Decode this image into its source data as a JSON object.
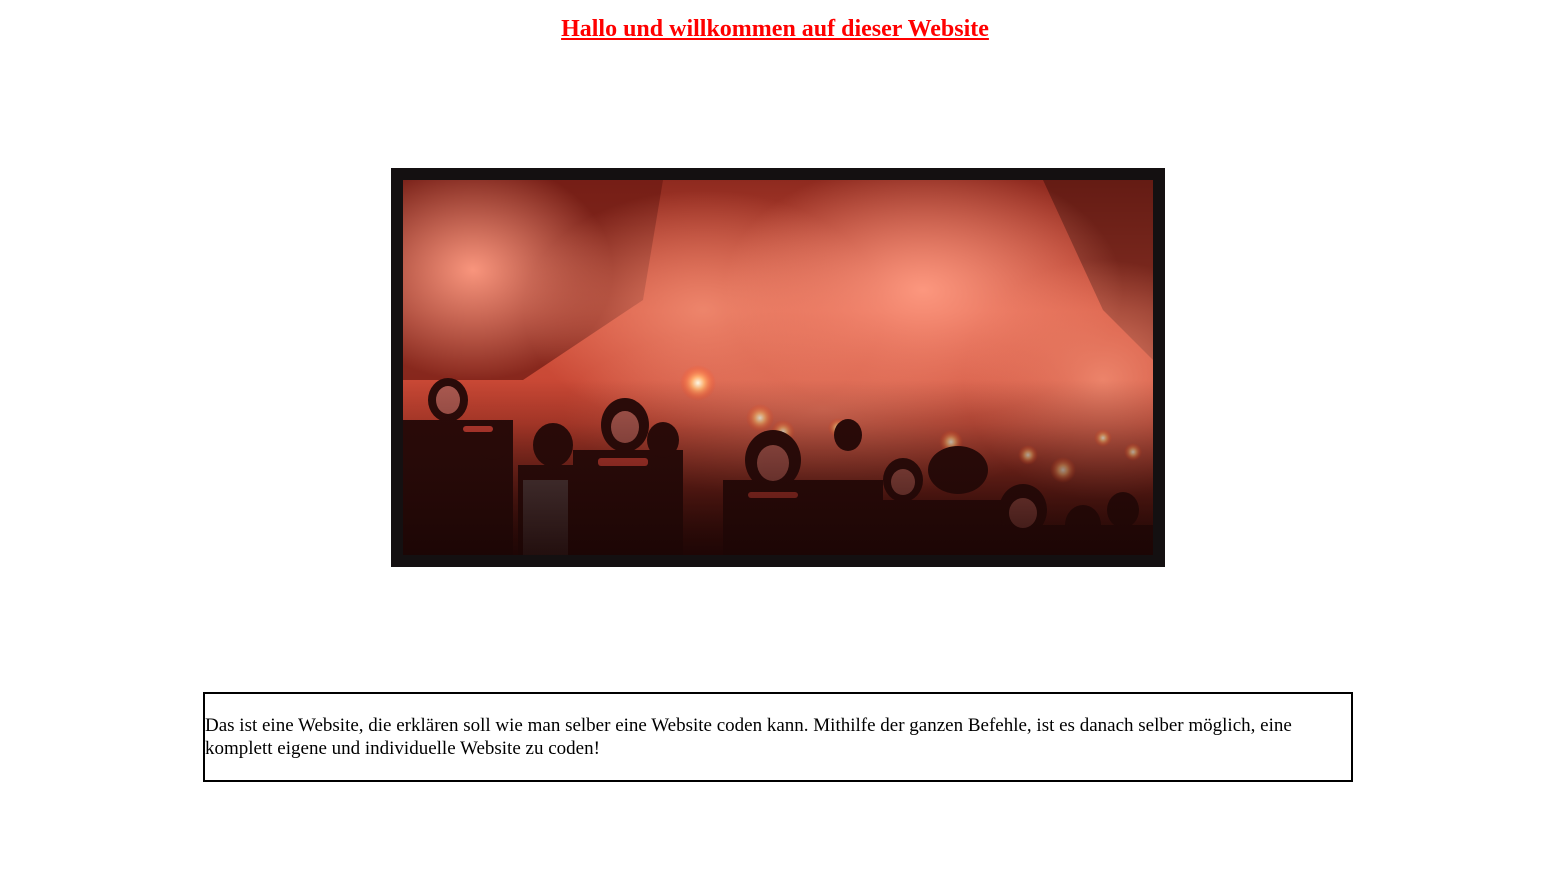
{
  "page": {
    "heading": "Hallo und willkommen auf dieser Website",
    "heading_color": "#ff0000"
  },
  "image": {
    "subject": "stadium-crowd-with-red-flares",
    "frame_color": "#141011"
  },
  "intro": {
    "text": "Das ist eine Website, die erklären soll wie man selber eine Website coden kann. Mithilfe der ganzen Befehle, ist es danach selber möglich, eine komplett eigene und individuelle Website zu coden!"
  }
}
